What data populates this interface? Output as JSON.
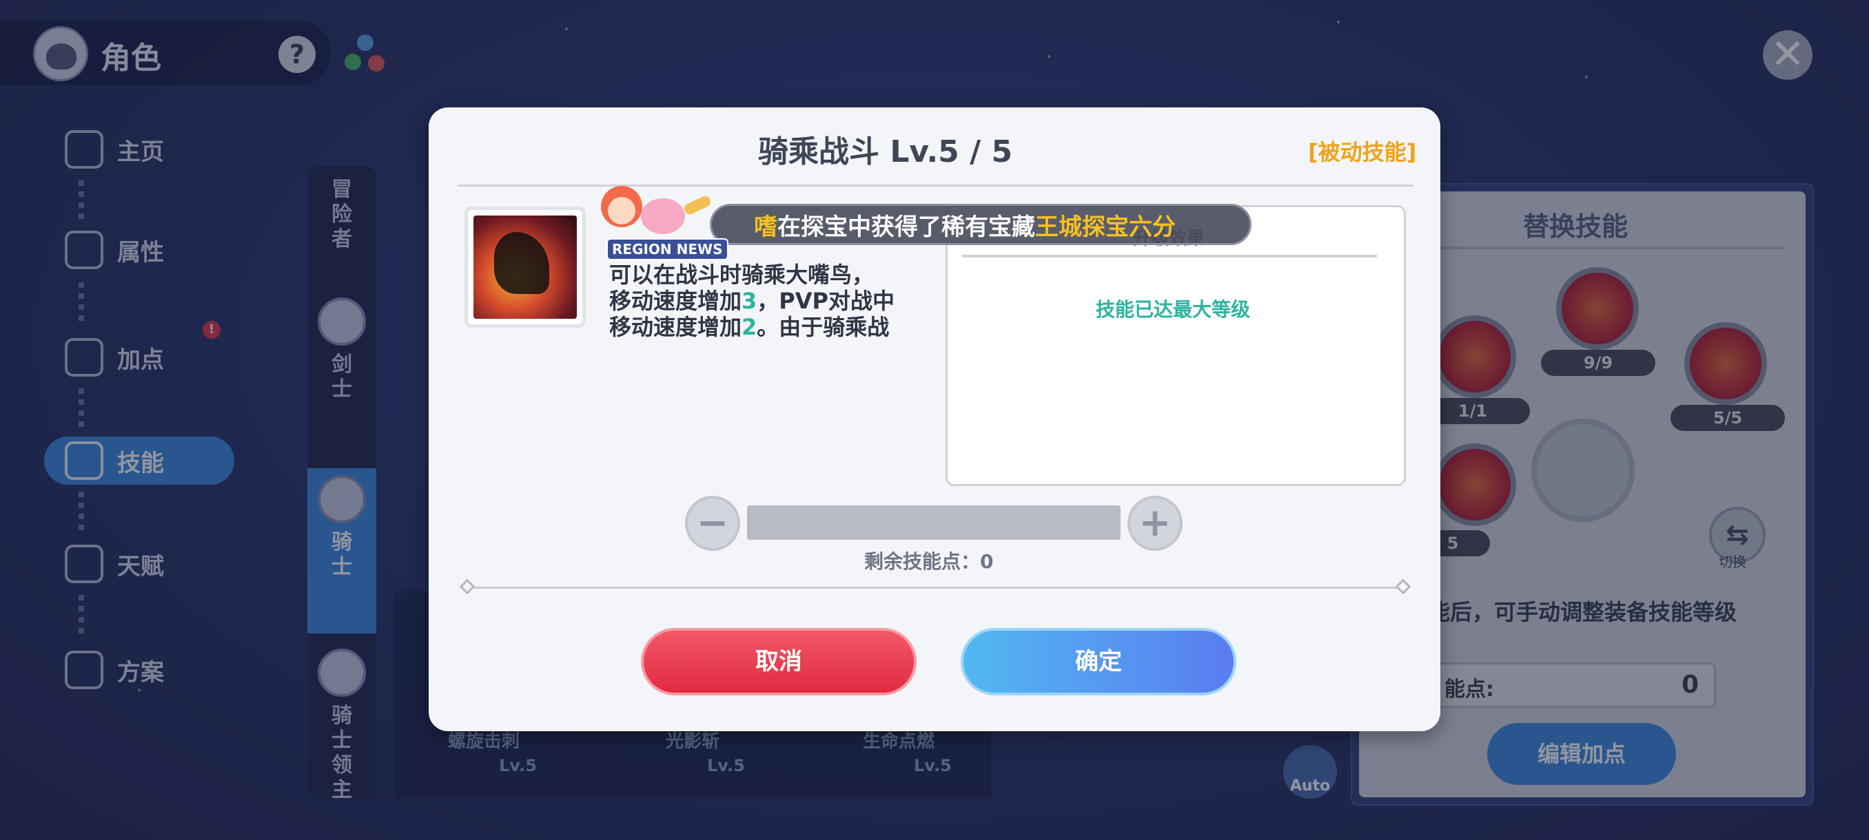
{
  "header": {
    "title": "角色"
  },
  "nav": [
    {
      "label": "主页"
    },
    {
      "label": "属性"
    },
    {
      "label": "加点"
    },
    {
      "label": "技能"
    },
    {
      "label": "天赋"
    },
    {
      "label": "方案"
    }
  ],
  "classes": [
    {
      "label": "冒\n险\n者"
    },
    {
      "label": "剑\n士"
    },
    {
      "label": "骑\n士"
    },
    {
      "label": "骑\n士\n领\n主"
    }
  ],
  "background_skills": [
    {
      "name": "螺旋击刺",
      "level": "Lv.5"
    },
    {
      "name": "光影斩",
      "level": "Lv.5"
    },
    {
      "name": "生命点燃",
      "level": "Lv.5"
    }
  ],
  "replace_panel": {
    "title": "替换技能",
    "badges": [
      "1/1",
      "9/9",
      "5/5",
      "5"
    ],
    "switch_label": "切换",
    "hint": "技能后，可手动调整装备技能等级",
    "points_label": "能点:",
    "points_value": "0",
    "edit_button": "编辑加点",
    "auto_label": "Auto"
  },
  "modal": {
    "title": "骑乘战斗 Lv.5 / 5",
    "passive_tag": "[被动技能]",
    "desc_1": "可以在战斗时骑乘大嘴鸟，",
    "desc_2a": "移动速度增加",
    "desc_2b": "3",
    "desc_2c": "，PVP对战中",
    "desc_3a": "移动速度增加",
    "desc_3b": "2",
    "desc_3c": "。由于骑乘战",
    "effect_title": "升级效果",
    "effect_max": "技能已达最大等级",
    "remaining": "剩余技能点：0",
    "cancel": "取消",
    "confirm": "确定"
  },
  "news": {
    "label": "REGION NEWS",
    "name": "嗜",
    "text": "在探宝中获得了稀有宝藏",
    "item": "王城探宝六分"
  },
  "colors": {
    "accent": "#3f8de0",
    "highlight": "#2bb4a0",
    "passive": "#f0a218",
    "cancel": "#e02b41"
  }
}
